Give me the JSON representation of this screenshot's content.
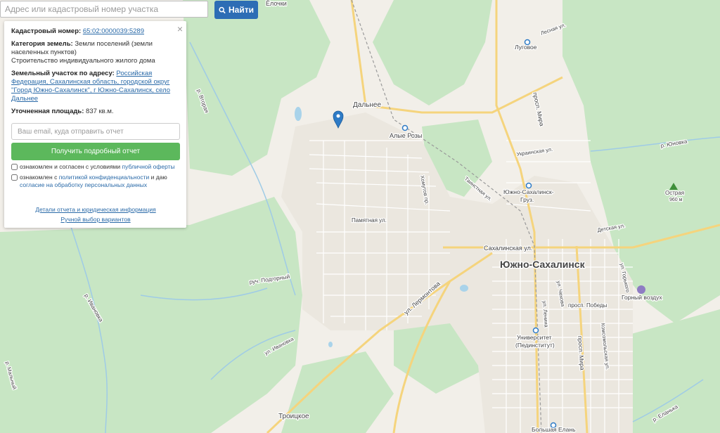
{
  "search": {
    "placeholder": "Адрес или кадастровый номер участка",
    "button_label": "Найти"
  },
  "panel": {
    "close_glyph": "×",
    "cadastral_label": "Кадастровый номер:",
    "cadastral_value": "65:02:0000039:5289",
    "category_label": "Категория земель:",
    "category_value": "Земли поселений (земли населенных пунктов)",
    "use_value": "Строительство индивидуального жилого дома",
    "address_label": "Земельный участок по адресу:",
    "address_value": "Российская Федерация, Сахалинская область, городской округ \"Город Южно-Сахалинск\", г Южно-Сахалинск, село Дальнее",
    "area_label": "Уточненная площадь:",
    "area_value": "837 кв.м.",
    "email_placeholder": "Ваш email, куда отправить отчет",
    "report_button": "Получить подробный отчет",
    "check1_text": "ознакомлен и согласен с условиями ",
    "check1_link": "публичной оферты",
    "check2_text": "ознакомлен с ",
    "check2_link": "политикой конфиденциальности",
    "check2_mid": " и даю ",
    "check2_link2": "согласие на обработку персональных данных",
    "link_details": "Детали отчета и юридическая информация",
    "link_manual": "Ручной выбор вариантов"
  },
  "map": {
    "colors": {
      "forest": "#c5e5c2",
      "water": "#a9d3ea",
      "road_major": "#f3d27c",
      "marker": "#2e7bc6"
    },
    "labels": {
      "elochki": "Ёлочки",
      "dalnee": "Дальнее",
      "alye_rozy": "Алые Розы",
      "lugovoe": "Луговое",
      "yuzhno_gruz": "Южно-Сахалинск-",
      "yuzhno_gruz2": "Груз.",
      "yuzhno": "Южно-Сахалинск",
      "ostraya": "Острая",
      "ostraya_alt": "960 м",
      "gorny_vozdukh": "Горный воздух",
      "universitet": "Университет",
      "universitet2": "(Пединститут)",
      "troitskoe": "Троицкое",
      "bolshaya_elan": "Большая Елань",
      "pamyatnaya": "Памятная ул.",
      "sakhalinskaya": "Сахалинская ул.",
      "lermontova": "ул. Лермонтова",
      "prosp_mira_n": "просп. Мира",
      "prosp_mira_s": "просп. Мира",
      "ukrainskaya": "Украинская ул.",
      "tainaya": "Таинстная ул.",
      "khomutova": "Хомутов пр.",
      "lesnaya": "Лесная ул.",
      "detskaya": "Детская ул.",
      "prosp_pobedy": "просп. Победы",
      "ul_chekhova": "ул. Чехова",
      "ul_lenina": "ул. Ленина",
      "ul_gorkogo": "ул. Горького",
      "komsomolskaya": "Комсомольская ул.",
      "r_yunovka": "р. Юновка",
      "r_vtoraya": "р. Вторая",
      "r_ivanovka": "р. Ивановка",
      "r_yelanka": "р. Еланька",
      "ruch_podgornyi": "руч. Подгорный",
      "ul_ivanovka": "ул. Ивановка",
      "r_malnyi": "р. Мальный"
    }
  }
}
